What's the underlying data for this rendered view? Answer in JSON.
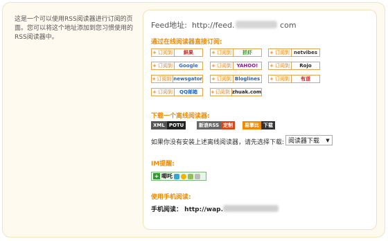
{
  "description": "这是一个可以使用RSS阅读器进行订阅的页面。您可以将这个地址添加到您习惯使用的RSS阅读器中。",
  "feed": {
    "label": "Feed地址:",
    "url_prefix": "http://feed.",
    "url_suffix": "com"
  },
  "online_section": {
    "title": "通过在线阅读器直接订阅:",
    "subscribe_label": "订阅到",
    "readers": [
      {
        "name": "鲜果",
        "color": "#d62020"
      },
      {
        "name": "抓虾",
        "color": "#3a9a2f"
      },
      {
        "name": "netvibes",
        "color": "#333333"
      },
      {
        "name": "Google",
        "color": "#3366cc"
      },
      {
        "name": "YAHOO!",
        "color": "#8b1a8b"
      },
      {
        "name": "Rojo",
        "color": "#222222"
      },
      {
        "name": "newsgator",
        "color": "#3366aa"
      },
      {
        "name": "Bloglines",
        "color": "#2d5c9a"
      },
      {
        "name": "有道",
        "color": "#cc2222"
      },
      {
        "name": "QQ邮箱",
        "color": "#1a66cc"
      },
      {
        "name": "zhuak.com",
        "color": "#222222"
      }
    ]
  },
  "download_section": {
    "title": "下载一个离线阅读器:",
    "buttons": [
      {
        "part1": "XML",
        "part2": "POTU"
      },
      {
        "part1": "新浪RSS",
        "part2": "定制"
      },
      {
        "part1": "易擎比",
        "part2": "下载"
      }
    ]
  },
  "prompt": "如果你没有安装上述离线阅读器，请先选择下载:",
  "select_value": "阅读器下载",
  "im_section": {
    "title": "IM提醒:",
    "label": "唧吒"
  },
  "mobile_section": {
    "title": "使用手机阅读:",
    "label": "手机阅读：",
    "url_prefix": "http://wap."
  }
}
